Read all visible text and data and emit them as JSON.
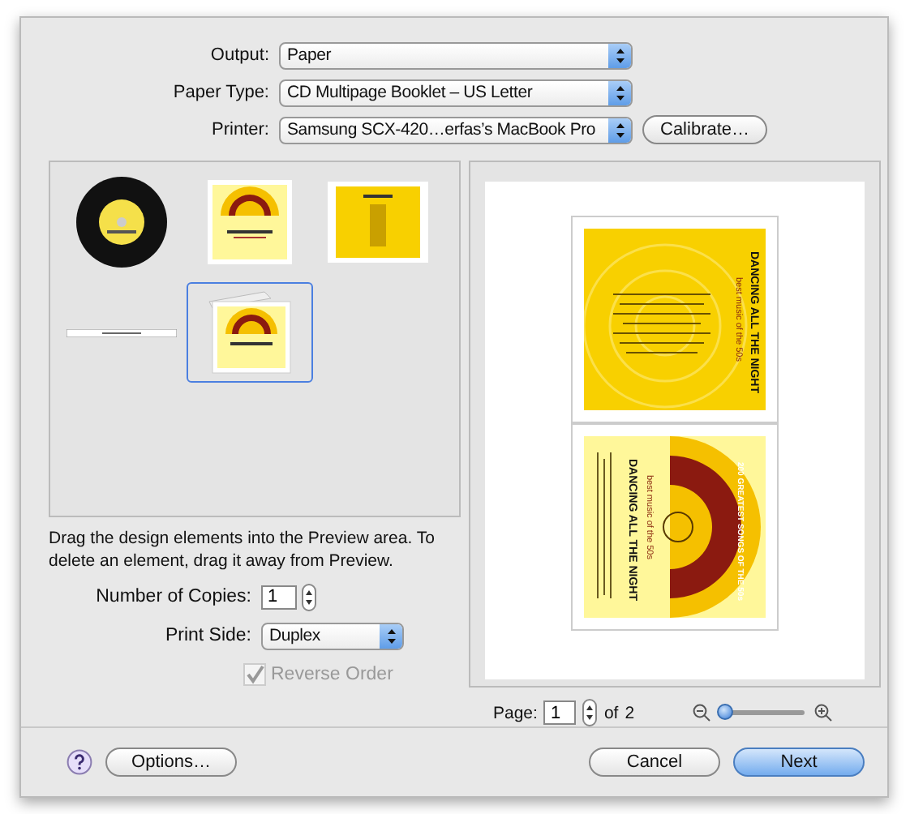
{
  "form": [
    {
      "label": "Output:",
      "value": "Paper"
    },
    {
      "label": "Paper Type:",
      "value": "CD Multipage Booklet – US Letter"
    },
    {
      "label": "Printer:",
      "value": "Samsung SCX-420…erfas’s MacBook Pro"
    }
  ],
  "calibrate_button": "Calibrate…",
  "design_elements": [
    {
      "kind": "disc",
      "selected": false
    },
    {
      "kind": "cover",
      "selected": false
    },
    {
      "kind": "tray",
      "selected": false
    },
    {
      "kind": "spine",
      "selected": false
    },
    {
      "kind": "booklet",
      "selected": true
    }
  ],
  "instructions": "Drag the design elements into the Preview area. To delete an element, drag it away from Preview.",
  "copies": {
    "label": "Number of Copies:",
    "value": "1"
  },
  "print_side": {
    "label": "Print Side:",
    "value": "Duplex"
  },
  "reverse_order": {
    "label": "Reverse Order",
    "checked": true,
    "disabled": true
  },
  "preview_pages": [
    {
      "kind": "tray",
      "title": "DANCING ALL THE NIGHT",
      "subtitle": "best music of the 50s"
    },
    {
      "kind": "cover",
      "title": "DANCING ALL THE NIGHT",
      "subtitle": "best music of the 50s",
      "arc_text": "200 GREATEST SONGS OF THE 50s"
    }
  ],
  "page_nav": {
    "label": "Page:",
    "value": "1",
    "of": "of",
    "total": "2"
  },
  "zoom": {
    "level": 0.05
  },
  "buttons": {
    "options": "Options…",
    "cancel": "Cancel",
    "next": "Next"
  }
}
